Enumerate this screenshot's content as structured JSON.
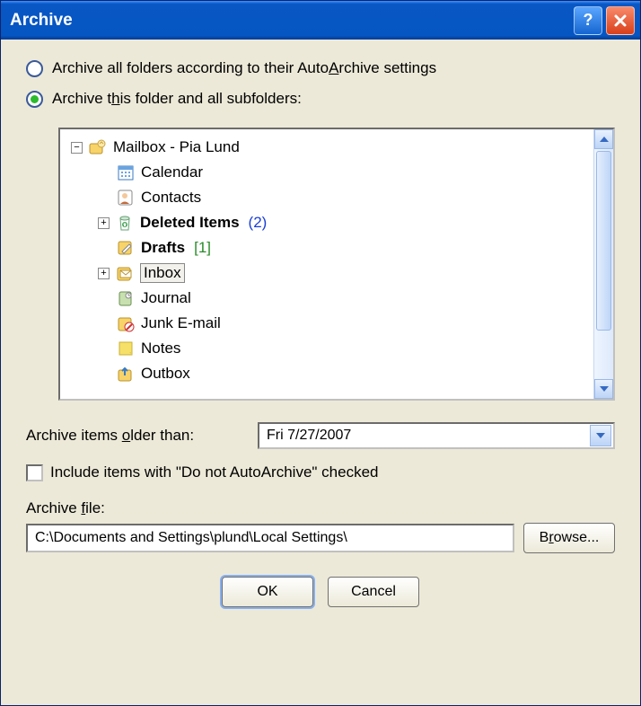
{
  "title": "Archive",
  "radios": {
    "all": "Archive all folders according to their AutoArchive settings",
    "this": "Archive this folder and all subfolders:",
    "selected": "this"
  },
  "tree": {
    "root": {
      "label": "Mailbox - Pia Lund",
      "children": {
        "calendar": "Calendar",
        "contacts": "Contacts",
        "deleted": "Deleted Items",
        "deleted_count": "(2)",
        "drafts": "Drafts",
        "drafts_count": "[1]",
        "inbox": "Inbox",
        "journal": "Journal",
        "junk": "Junk E-mail",
        "notes": "Notes",
        "outbox": "Outbox"
      }
    }
  },
  "older_label": "Archive items older than:",
  "older_value": "Fri 7/27/2007",
  "include_label": "Include items with \"Do not AutoArchive\" checked",
  "file_label": "Archive file:",
  "file_value": "C:\\Documents and Settings\\plund\\Local Settings\\",
  "browse_label": "Browse...",
  "ok_label": "OK",
  "cancel_label": "Cancel"
}
